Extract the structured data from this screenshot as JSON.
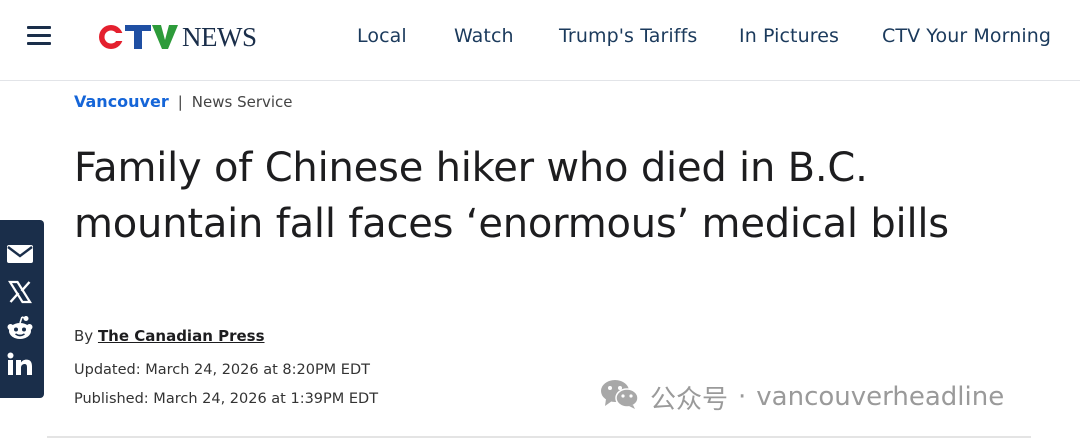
{
  "header": {
    "logo_ctv": "CTV",
    "logo_news": "NEWS",
    "nav": [
      "Local",
      "Watch",
      "Trump's Tariffs",
      "In Pictures",
      "CTV Your Morning"
    ]
  },
  "breadcrumb": {
    "section": "Vancouver",
    "separator": "|",
    "service": "News Service"
  },
  "article": {
    "headline": "Family of Chinese hiker who died in B.C. mountain fall faces ‘enormous’ medical bills",
    "byline_prefix": "By",
    "author": "The Canadian Press",
    "updated": "Updated: March 24, 2026 at 8:20PM EDT",
    "published": "Published: March 24, 2026 at 1:39PM EDT"
  },
  "share": {
    "icons": [
      "email-icon",
      "x-icon",
      "reddit-icon",
      "linkedin-icon"
    ]
  },
  "watermark": {
    "label": "公众号",
    "dot": "·",
    "handle": "vancouverheadline"
  },
  "colors": {
    "brand_navy": "#1a2e4a",
    "link_blue": "#1565d8",
    "ctv_red": "#e4202e",
    "ctv_blue": "#1f4fa3",
    "ctv_green": "#2d9b3a"
  }
}
